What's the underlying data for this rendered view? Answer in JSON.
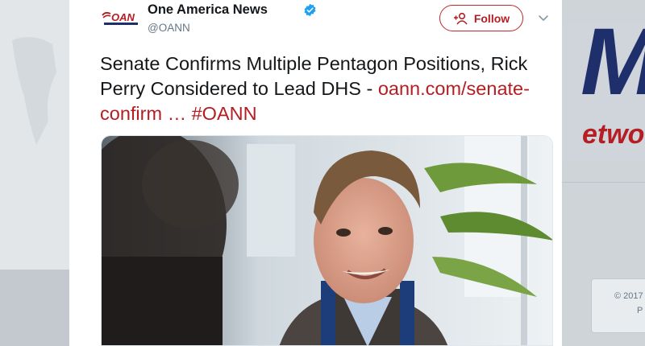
{
  "tweet": {
    "display_name": "One America News",
    "handle": "@OANN",
    "follow_label": "Follow",
    "text_main": "Senate Confirms Multiple Pentagon Positions, Rick Perry Considered to Lead DHS - ",
    "link": "oann.com/senate-confirm",
    "ellipsis": " … ",
    "hashtag": "#OANN",
    "avatar_logo_text": "OAN",
    "colors": {
      "accent": "#b31e23",
      "verified": "#1da1f2",
      "text": "#14171a",
      "muted": "#657786"
    }
  },
  "background": {
    "banner_letter": "M",
    "banner_text": "etwo",
    "copyright": "© 2017",
    "footer_letter": "P"
  },
  "icons": [
    "oan-logo",
    "verified-icon",
    "follow-icon",
    "chevron-down-icon"
  ]
}
